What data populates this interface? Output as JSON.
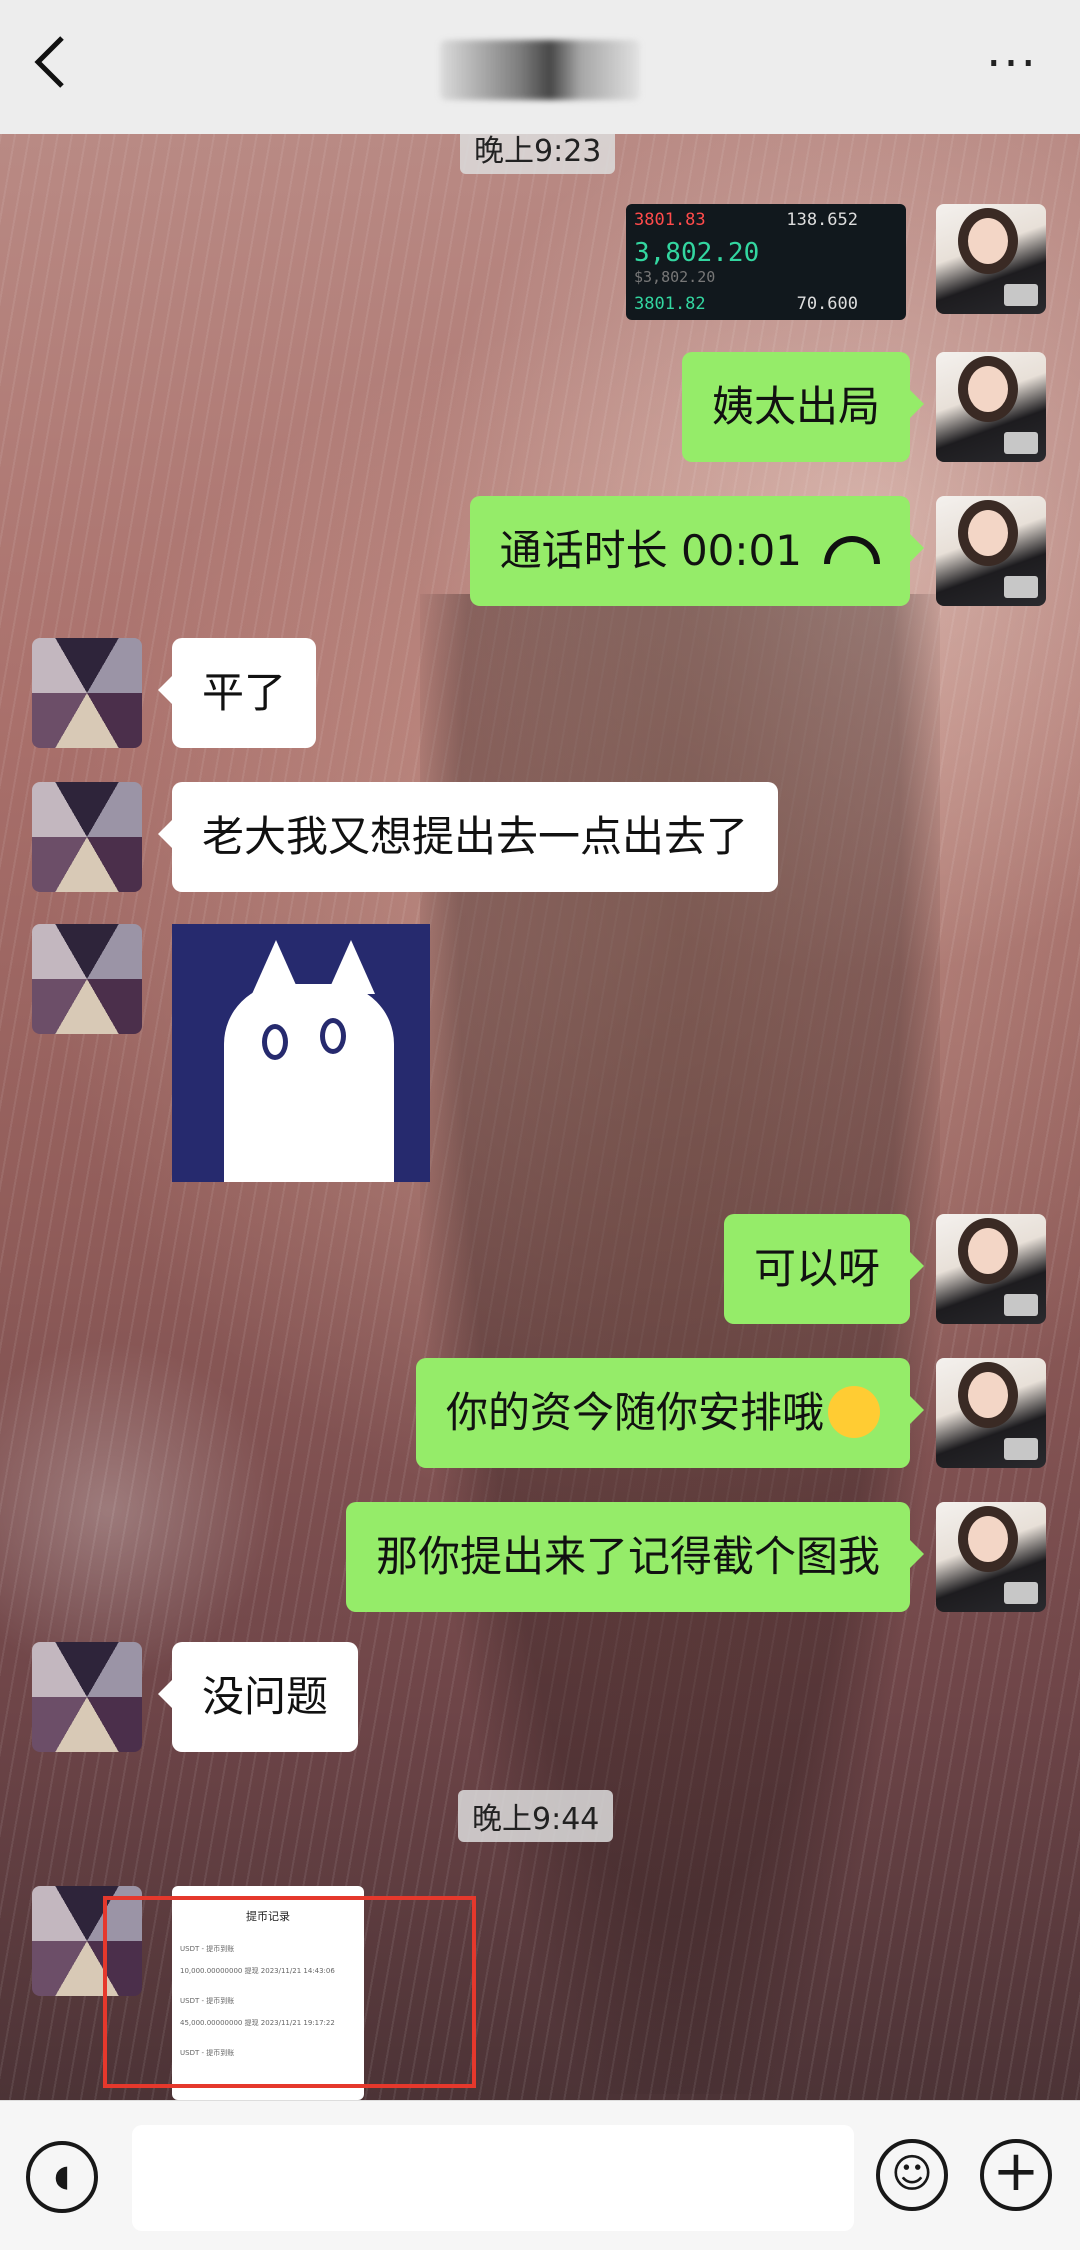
{
  "header": {
    "back_icon": "chevron-left-icon",
    "title": "",
    "more_icon": "more-dots-icon"
  },
  "messages": {
    "ts1": "晚上9:23",
    "quote": {
      "top_left": "3801.83",
      "top_right": "138.652",
      "price": "3,802.20",
      "price_usd": "$3,802.20",
      "bottom_left": "3801.82",
      "bottom_right": "70.600"
    },
    "m1": "姨太出局",
    "m2_text": "通话时长 00:01",
    "m3": "平了",
    "m4": "老大我又想提出去一点出去了",
    "m5": "可以呀",
    "m6": "你的资今随你安排哦",
    "m7": "那你提出来了记得截个图我",
    "m8": "没问题",
    "ts2": "晚上9:44",
    "thumb": {
      "title": "提币记录",
      "rows": [
        "USDT - 提币到账",
        "10,000.00000000   提现   2023/11/21 14:43:06",
        "USDT - 提币到账",
        "45,000.00000000   提现   2023/11/21 19:17:22",
        "USDT - 提币到账"
      ]
    }
  },
  "footer": {
    "voice_icon": "voice-icon",
    "emoji_icon": "emoji-icon",
    "plus_icon": "plus-icon"
  },
  "colors": {
    "my_bubble": "#95ec69",
    "other_bubble": "#ffffff",
    "highlight_box": "#e5382c"
  }
}
